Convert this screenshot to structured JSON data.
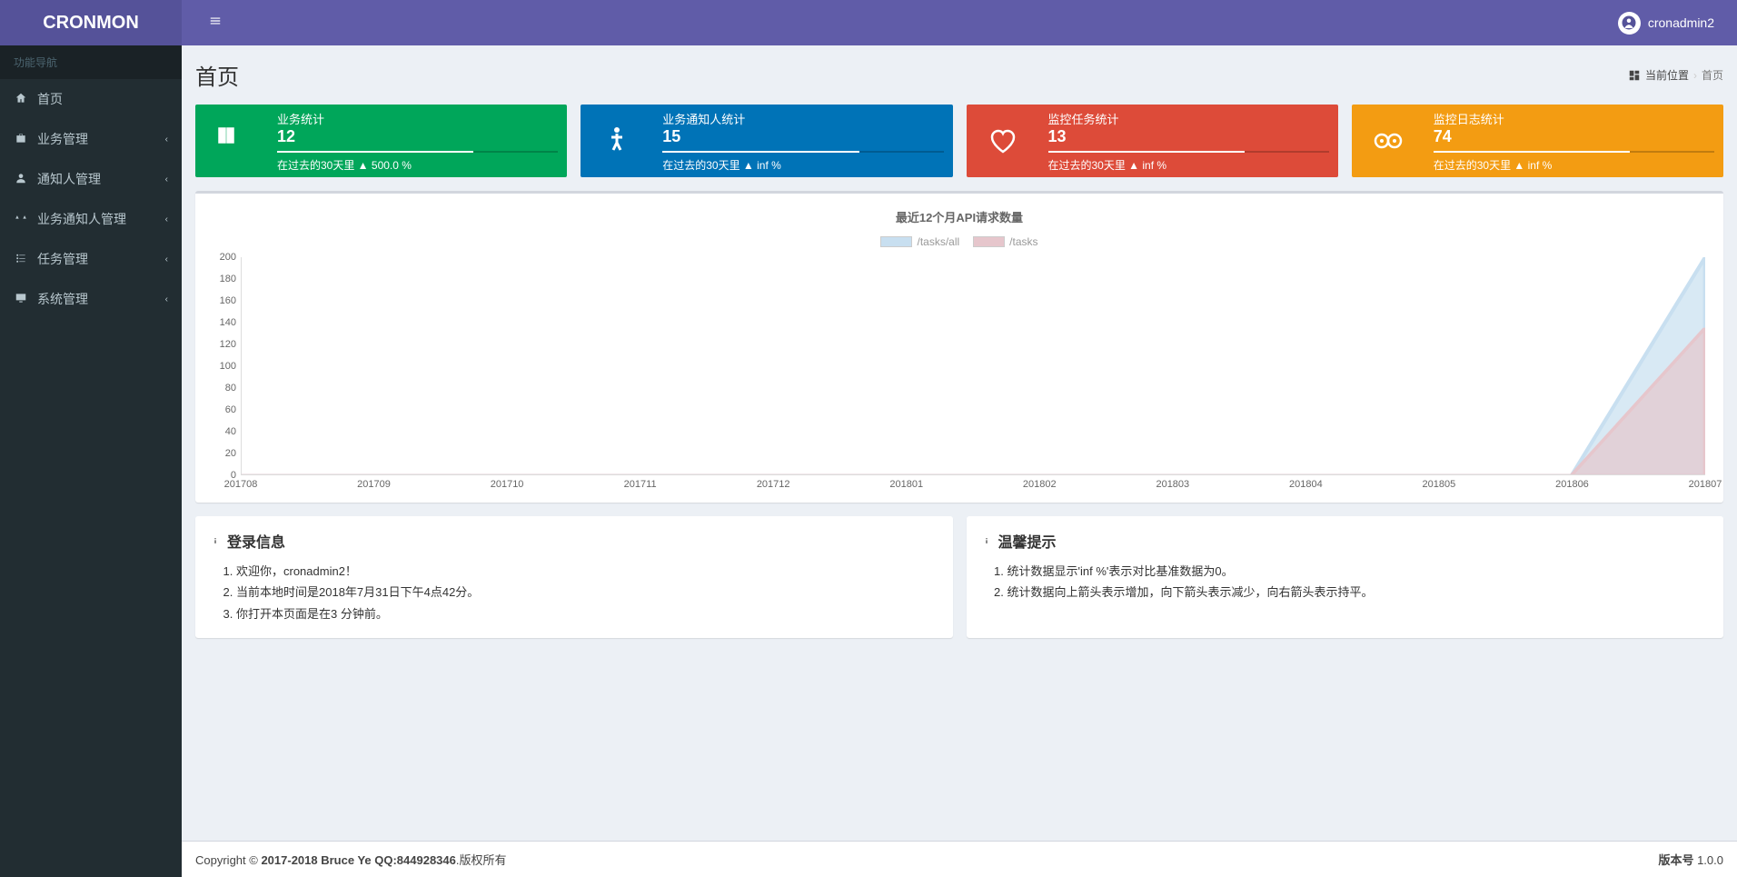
{
  "app": {
    "name": "CRONMON"
  },
  "user": {
    "name": "cronadmin2"
  },
  "sidebar": {
    "header": "功能导航",
    "items": [
      {
        "label": "首页",
        "icon": "home",
        "children": false
      },
      {
        "label": "业务管理",
        "icon": "briefcase",
        "children": true
      },
      {
        "label": "通知人管理",
        "icon": "user",
        "children": true
      },
      {
        "label": "业务通知人管理",
        "icon": "balance",
        "children": true
      },
      {
        "label": "任务管理",
        "icon": "tasks",
        "children": true
      },
      {
        "label": "系统管理",
        "icon": "display",
        "children": true
      }
    ]
  },
  "page": {
    "title": "首页",
    "breadcrumb": {
      "location_label": "当前位置",
      "current": "首页"
    }
  },
  "stats": [
    {
      "title": "业务统计",
      "value": "12",
      "footer": "在过去的30天里 ▲ 500.0 %",
      "color": "green",
      "icon": "book"
    },
    {
      "title": "业务通知人统计",
      "value": "15",
      "footer": "在过去的30天里 ▲ inf %",
      "color": "blue",
      "icon": "person"
    },
    {
      "title": "监控任务统计",
      "value": "13",
      "footer": "在过去的30天里 ▲ inf %",
      "color": "red",
      "icon": "heart"
    },
    {
      "title": "监控日志统计",
      "value": "74",
      "footer": "在过去的30天里 ▲ inf %",
      "color": "yellow",
      "icon": "eyes"
    }
  ],
  "chart_data": {
    "type": "area",
    "title": "最近12个月API请求数量",
    "xlabel": "",
    "ylabel": "",
    "ylim": [
      0,
      200
    ],
    "yticks": [
      0,
      20,
      40,
      60,
      80,
      100,
      120,
      140,
      160,
      180,
      200
    ],
    "categories": [
      "201708",
      "201709",
      "201710",
      "201711",
      "201712",
      "201801",
      "201802",
      "201803",
      "201804",
      "201805",
      "201806",
      "201807"
    ],
    "series": [
      {
        "name": "/tasks/all",
        "color": "#c8dff0",
        "values": [
          0,
          0,
          0,
          0,
          0,
          0,
          0,
          0,
          0,
          0,
          0,
          200
        ]
      },
      {
        "name": "/tasks",
        "color": "#e6c6cc",
        "values": [
          0,
          0,
          0,
          0,
          0,
          0,
          0,
          0,
          0,
          0,
          0,
          135
        ]
      }
    ]
  },
  "login_info": {
    "title": "登录信息",
    "items": [
      "欢迎你，cronadmin2！",
      "当前本地时间是2018年7月31日下午4点42分。",
      "你打开本页面是在3 分钟前。"
    ]
  },
  "tips": {
    "title": "温馨提示",
    "items": [
      "统计数据显示'inf %'表示对比基准数据为0。",
      "统计数据向上箭头表示增加，向下箭头表示减少，向右箭头表示持平。"
    ]
  },
  "footer": {
    "copyright_prefix": "Copyright © ",
    "copyright_bold": "2017-2018 Bruce Ye QQ:844928346",
    "copyright_suffix": ".版权所有",
    "version_label": "版本号",
    "version": "1.0.0"
  }
}
